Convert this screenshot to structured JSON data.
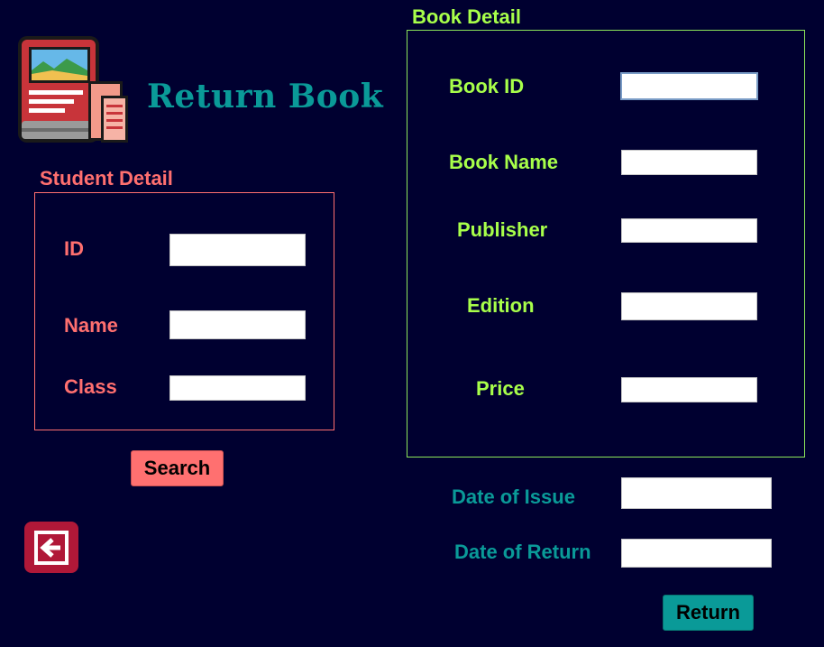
{
  "header": {
    "title": "Return Book",
    "logo_icon": "book-documents-icon"
  },
  "student": {
    "group_label": "Student Detail",
    "id_label": "ID",
    "name_label": "Name",
    "class_label": "Class",
    "id_value": "",
    "name_value": "",
    "class_value": ""
  },
  "book": {
    "group_label": "Book Detail",
    "book_id_label": "Book ID",
    "book_name_label": "Book Name",
    "publisher_label": "Publisher",
    "edition_label": "Edition",
    "price_label": "Price",
    "book_id_value": "",
    "book_name_value": "",
    "publisher_value": "",
    "edition_value": "",
    "price_value": ""
  },
  "dates": {
    "issue_label": "Date of Issue",
    "return_label": "Date of Return",
    "issue_value": "",
    "return_value": ""
  },
  "buttons": {
    "search_label": "Search",
    "return_label": "Return",
    "back_icon": "back-arrow-icon"
  },
  "colors": {
    "background": "#000030",
    "student_accent": "#ff6f6f",
    "book_accent": "#a8ff4a",
    "title_teal": "#0a9a98",
    "back_button": "#b01838"
  }
}
